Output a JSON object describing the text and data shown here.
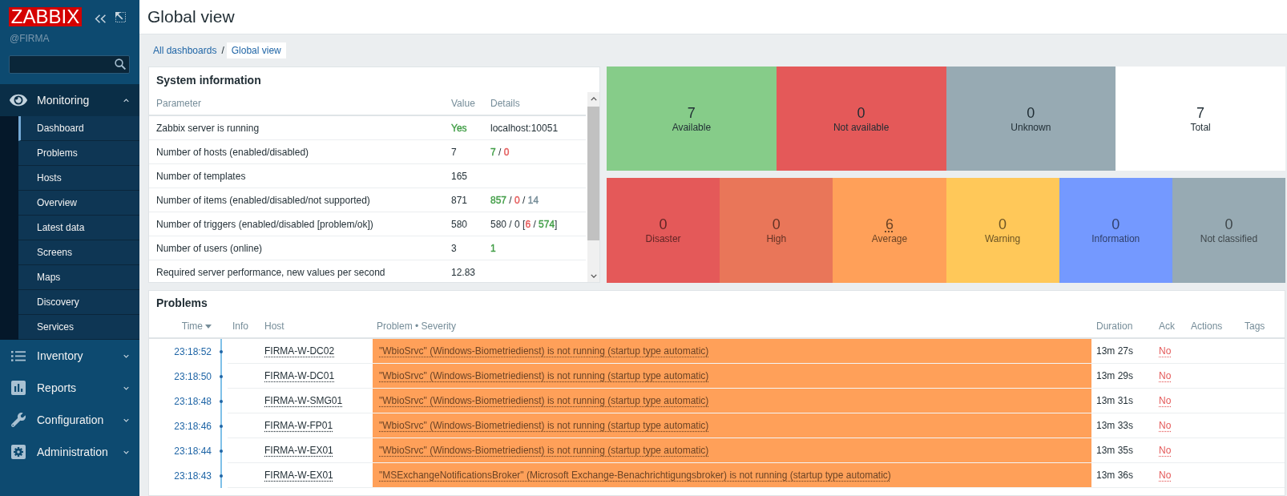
{
  "sidebar": {
    "logo": "ZABBIX",
    "server_name": "@FIRMA",
    "menu": [
      {
        "label": "Monitoring",
        "expanded": true,
        "children": [
          {
            "label": "Dashboard",
            "selected": true
          },
          {
            "label": "Problems",
            "selected": false
          },
          {
            "label": "Hosts",
            "selected": false
          },
          {
            "label": "Overview",
            "selected": false
          },
          {
            "label": "Latest data",
            "selected": false
          },
          {
            "label": "Screens",
            "selected": false
          },
          {
            "label": "Maps",
            "selected": false
          },
          {
            "label": "Discovery",
            "selected": false
          },
          {
            "label": "Services",
            "selected": false
          }
        ]
      },
      {
        "label": "Inventory",
        "expanded": false
      },
      {
        "label": "Reports",
        "expanded": false
      },
      {
        "label": "Configuration",
        "expanded": false
      },
      {
        "label": "Administration",
        "expanded": false
      }
    ]
  },
  "header": {
    "title": "Global view"
  },
  "breadcrumbs": {
    "separator": "/",
    "items": [
      {
        "label": "All dashboards",
        "selected": false
      },
      {
        "label": "Global view",
        "selected": true
      }
    ]
  },
  "system_information": {
    "title": "System information",
    "columns": [
      "Parameter",
      "Value",
      "Details"
    ],
    "rows": [
      {
        "parameter": "Zabbix server is running",
        "value": [
          {
            "text": "Yes",
            "color": "#429e47"
          }
        ],
        "details": [
          {
            "text": "localhost:10051"
          }
        ]
      },
      {
        "parameter": "Number of hosts (enabled/disabled)",
        "value": [
          {
            "text": "7"
          }
        ],
        "details": [
          {
            "text": "7",
            "color": "#429e47"
          },
          {
            "text": " / "
          },
          {
            "text": "0",
            "color": "#e45959"
          }
        ]
      },
      {
        "parameter": "Number of templates",
        "value": [
          {
            "text": "165"
          }
        ]
      },
      {
        "parameter": "Number of items (enabled/disabled/not supported)",
        "value": [
          {
            "text": "871"
          }
        ],
        "details": [
          {
            "text": "857",
            "color": "#429e47"
          },
          {
            "text": " / "
          },
          {
            "text": "0",
            "color": "#e45959"
          },
          {
            "text": " / "
          },
          {
            "text": "14",
            "color": "#768d99"
          }
        ]
      },
      {
        "parameter": "Number of triggers (enabled/disabled [problem/ok])",
        "value": [
          {
            "text": "580"
          }
        ],
        "details": [
          {
            "text": "580 / 0 ["
          },
          {
            "text": "6",
            "color": "#e45959"
          },
          {
            "text": " / "
          },
          {
            "text": "574",
            "color": "#429e47"
          },
          {
            "text": "]"
          }
        ]
      },
      {
        "parameter": "Number of users (online)",
        "value": [
          {
            "text": "3"
          }
        ],
        "details": [
          {
            "text": "1",
            "color": "#429e47"
          }
        ]
      },
      {
        "parameter": "Required server performance, new values per second",
        "value": [
          {
            "text": "12.83"
          }
        ]
      }
    ]
  },
  "host_availability": {
    "tiles": [
      {
        "count": "7",
        "label": "Available",
        "color": "#86cc89"
      },
      {
        "count": "0",
        "label": "Not available",
        "color": "#e45959"
      },
      {
        "count": "0",
        "label": "Unknown",
        "color": "#97aab3"
      },
      {
        "count": "7",
        "label": "Total",
        "color": "#ffffff"
      }
    ]
  },
  "problems_by_severity": {
    "tiles": [
      {
        "count": "0",
        "label": "Disaster",
        "color": "#e45959",
        "linked": false
      },
      {
        "count": "0",
        "label": "High",
        "color": "#e97659",
        "linked": false
      },
      {
        "count": "6",
        "label": "Average",
        "color": "#ffa059",
        "linked": true
      },
      {
        "count": "0",
        "label": "Warning",
        "color": "#ffc859",
        "linked": false
      },
      {
        "count": "0",
        "label": "Information",
        "color": "#7499ff",
        "linked": false
      },
      {
        "count": "0",
        "label": "Not classified",
        "color": "#97aab3",
        "linked": false
      }
    ]
  },
  "problems": {
    "title": "Problems",
    "columns": [
      {
        "label": "Time",
        "sorted": true
      },
      {
        "label": "Info",
        "sorted": false
      },
      {
        "label": "Host",
        "sorted": false
      },
      {
        "label": "Problem • Severity",
        "sorted": false
      },
      {
        "label": "Duration",
        "sorted": false
      },
      {
        "label": "Ack",
        "sorted": false
      },
      {
        "label": "Actions",
        "sorted": false
      },
      {
        "label": "Tags",
        "sorted": false
      }
    ],
    "rows": [
      {
        "time": "23:18:52",
        "host": "FIRMA-W-DC02",
        "problem": "\"WbioSrvc\" (Windows-Biometriedienst) is not running (startup type automatic)",
        "color": "#ffa059",
        "duration": "13m 27s",
        "ack": "No",
        "acknowledged": false
      },
      {
        "time": "23:18:50",
        "host": "FIRMA-W-DC01",
        "problem": "\"WbioSrvc\" (Windows-Biometriedienst) is not running (startup type automatic)",
        "color": "#ffa059",
        "duration": "13m 29s",
        "ack": "No",
        "acknowledged": false
      },
      {
        "time": "23:18:48",
        "host": "FIRMA-W-SMG01",
        "problem": "\"WbioSrvc\" (Windows-Biometriedienst) is not running (startup type automatic)",
        "color": "#ffa059",
        "duration": "13m 31s",
        "ack": "No",
        "acknowledged": false
      },
      {
        "time": "23:18:46",
        "host": "FIRMA-W-FP01",
        "problem": "\"WbioSrvc\" (Windows-Biometriedienst) is not running (startup type automatic)",
        "color": "#ffa059",
        "duration": "13m 33s",
        "ack": "No",
        "acknowledged": false
      },
      {
        "time": "23:18:44",
        "host": "FIRMA-W-EX01",
        "problem": "\"WbioSrvc\" (Windows-Biometriedienst) is not running (startup type automatic)",
        "color": "#ffa059",
        "duration": "13m 35s",
        "ack": "No",
        "acknowledged": false
      },
      {
        "time": "23:18:43",
        "host": "FIRMA-W-EX01",
        "problem": "\"MSExchangeNotificationsBroker\" (Microsoft Exchange-Benachrichtigungsbroker) is not running (startup type automatic)",
        "color": "#ffa059",
        "duration": "13m 36s",
        "ack": "No",
        "acknowledged": false
      }
    ]
  }
}
